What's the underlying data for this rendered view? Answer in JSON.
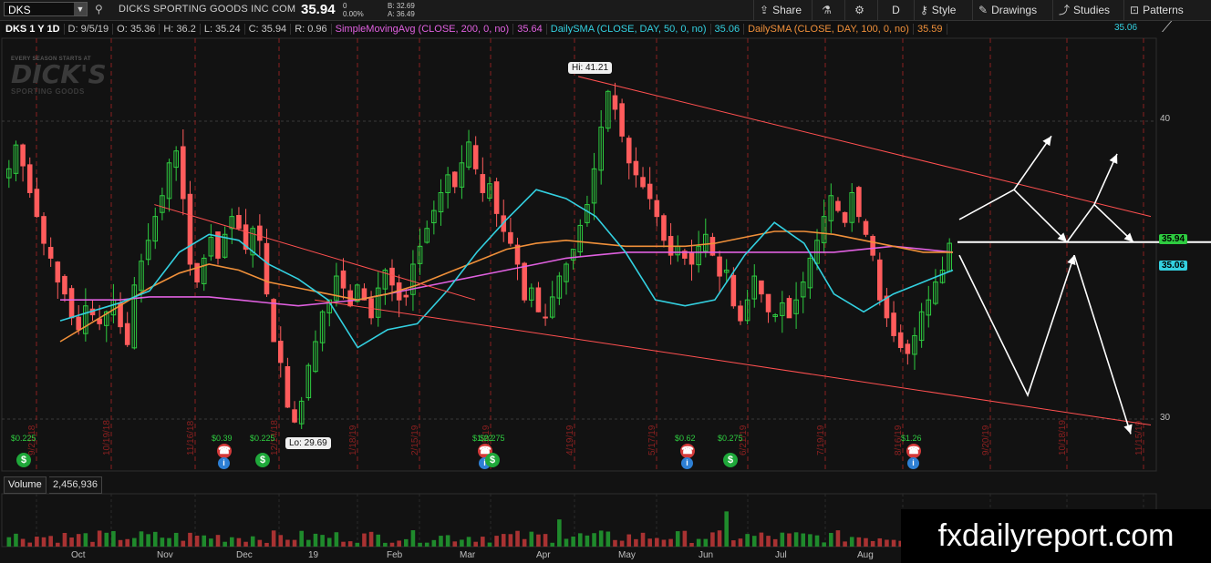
{
  "toolbar": {
    "symbol": "DKS",
    "company": "DICKS SPORTING GOODS INC COM",
    "last": "35.94",
    "change": "0",
    "change_pct": "0.00%",
    "bid": "B: 32.69",
    "ask": "A: 36.49",
    "share": "Share",
    "period": "D",
    "style": "Style",
    "drawings": "Drawings",
    "studies": "Studies",
    "patterns": "Patterns"
  },
  "studybar": {
    "title": "DKS 1 Y 1D",
    "date": "D: 9/5/19",
    "open": "O: 35.36",
    "high": "H: 36.2",
    "low": "L: 35.24",
    "close": "C: 35.94",
    "range": "R: 0.96",
    "sma200": "SimpleMovingAvg (CLOSE, 200, 0, no)",
    "sma200_val": "35.64",
    "sma50": "DailySMA (CLOSE, DAY, 50, 0, no)",
    "sma50_val": "35.06",
    "sma100": "DailySMA (CLOSE, DAY, 100, 0, no)",
    "sma100_val": "35.59",
    "right_val": "35.06"
  },
  "watermark": {
    "tagline": "EVERY SEASON STARTS AT",
    "logo": "DICK'S",
    "sub": "SPORTING GOODS"
  },
  "volume": {
    "label": "Volume",
    "value": "2,456,936"
  },
  "brand": "fxdailyreport.com",
  "chart_data": {
    "type": "candlestick",
    "title": "DKS 1 Y 1D",
    "ylim": [
      27,
      44
    ],
    "y_ticks": [
      "40",
      "30"
    ],
    "months": [
      "Oct",
      "Nov",
      "Dec",
      "19",
      "Feb",
      "Mar",
      "Apr",
      "May",
      "Jun",
      "Jul",
      "Aug"
    ],
    "hi": {
      "label": "Hi: 41.21",
      "value": 41.21
    },
    "lo": {
      "label": "Lo: 29.69",
      "value": 29.69
    },
    "last_tag": "35.94",
    "sma_tag": "35.06",
    "close_series": [
      38.4,
      39.2,
      38.5,
      37.6,
      36.8,
      35.9,
      35.4,
      34.6,
      34.2,
      33.4,
      33.0,
      33.8,
      33.5,
      33.2,
      33.6,
      34.0,
      33.1,
      32.5,
      34.5,
      35.3,
      36.0,
      36.8,
      37.5,
      38.6,
      39.0,
      37.4,
      35.2,
      34.6,
      35.4,
      36.1,
      35.4,
      36.2,
      36.8,
      36.4,
      35.7,
      36.4,
      36.0,
      34.2,
      32.6,
      31.9,
      30.4,
      29.9,
      30.6,
      31.8,
      32.6,
      33.6,
      34.0,
      34.8,
      34.4,
      33.8,
      34.5,
      34.0,
      33.4,
      34.4,
      35.0,
      34.5,
      34.0,
      34.1,
      35.2,
      35.8,
      36.4,
      37.0,
      37.6,
      38.2,
      37.8,
      38.6,
      39.3,
      38.4,
      37.6,
      37.9,
      36.9,
      36.3,
      35.9,
      35.2,
      34.0,
      34.4,
      33.6,
      33.4,
      34.1,
      34.8,
      35.2,
      35.7,
      36.5,
      37.2,
      38.4,
      39.8,
      41.0,
      40.4,
      39.5,
      38.6,
      38.2,
      37.8,
      37.4,
      36.8,
      36.0,
      35.5,
      35.8,
      35.4,
      35.2,
      35.8,
      36.2,
      35.5,
      34.8,
      35.0,
      33.8,
      33.3,
      34.0,
      34.8,
      34.2,
      33.6,
      33.5,
      33.9,
      33.4,
      34.0,
      34.6,
      35.4,
      36.0,
      36.8,
      37.5,
      37.0,
      36.6,
      37.6,
      36.8,
      36.2,
      35.5,
      34.0,
      33.4,
      32.8,
      32.4,
      32.2,
      32.8,
      33.6,
      34.0,
      34.6,
      35.0,
      35.9
    ],
    "sma_50": [
      33.3,
      33.6,
      33.9,
      34.3,
      35.6,
      36.2,
      36.0,
      35.2,
      34.7,
      34.0,
      32.4,
      33.0,
      33.2,
      34.3,
      35.6,
      36.7,
      37.7,
      37.4,
      36.8,
      35.6,
      34.0,
      33.8,
      34.0,
      35.5,
      36.6,
      35.9,
      34.2,
      33.6,
      34.2,
      34.6,
      35.0
    ],
    "sma_100": [
      32.6,
      33.2,
      33.8,
      34.4,
      34.9,
      35.2,
      35.0,
      34.6,
      34.4,
      34.2,
      34.0,
      34.2,
      34.5,
      34.9,
      35.3,
      35.7,
      35.9,
      36.0,
      35.9,
      35.8,
      35.8,
      35.8,
      35.9,
      36.1,
      36.3,
      36.3,
      36.2,
      36.0,
      35.8,
      35.6,
      35.6
    ],
    "sma_200": [
      34.0,
      34.0,
      34.0,
      34.1,
      34.1,
      34.1,
      34.0,
      33.9,
      33.8,
      33.9,
      34.0,
      34.2,
      34.4,
      34.6,
      34.8,
      35.0,
      35.2,
      35.4,
      35.5,
      35.6,
      35.6,
      35.6,
      35.6,
      35.6,
      35.6,
      35.6,
      35.6,
      35.7,
      35.8,
      35.7,
      35.6
    ],
    "channel_upper": [
      [
        0.32,
        37.7
      ],
      [
        1.0,
        33.1
      ]
    ],
    "channel_mid": [
      [
        0.13,
        37.0
      ],
      [
        0.9,
        28.9
      ]
    ],
    "channel_lower": [
      [
        0.0,
        38.6
      ],
      [
        1.0,
        28.9
      ]
    ],
    "events": [
      {
        "label": "$0.225",
        "kind": "dividend"
      },
      {
        "label": "$0.39",
        "kind": "earnings"
      },
      {
        "label": "$0.225",
        "kind": "dividend"
      },
      {
        "label": "$1.22",
        "kind": "earnings"
      },
      {
        "label": "$0.275",
        "kind": "dividend"
      },
      {
        "label": "$0.62",
        "kind": "earnings"
      },
      {
        "label": "$0.275",
        "kind": "dividend"
      },
      {
        "label": "$1.26",
        "kind": "earnings"
      }
    ],
    "vlines": [
      "9/21/18",
      "10/19/18",
      "11/16/18",
      "12/14/18",
      "1/18/19",
      "2/15/19",
      "3/15/19",
      "4/19/19",
      "5/17/19",
      "6/21/19",
      "7/19/19",
      "8/16/19",
      "9/20/19",
      "10/18/19",
      "11/15/19"
    ]
  }
}
